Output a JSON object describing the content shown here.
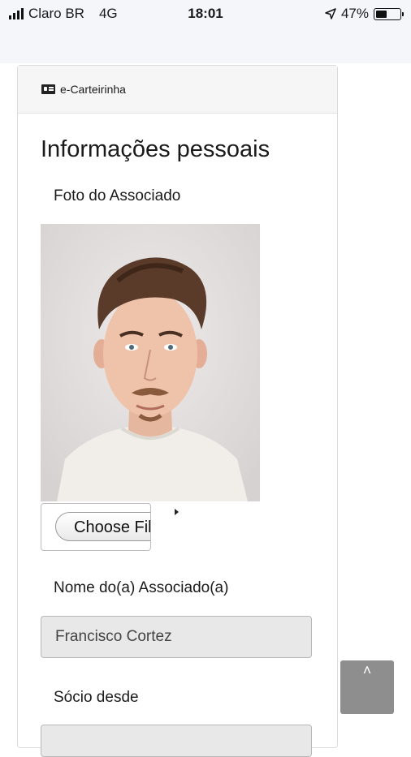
{
  "status_bar": {
    "carrier": "Claro BR",
    "network": "4G",
    "time": "18:01",
    "battery_percent": "47%",
    "battery_level": 0.47
  },
  "header": {
    "title": "e-Carteirinha",
    "icon": "id-card-icon"
  },
  "section": {
    "title": "Informações pessoais"
  },
  "photo": {
    "label": "Foto do Associado",
    "file_button_label": "Choose File"
  },
  "name": {
    "label": "Nome do(a) Associado(a)",
    "value": "Francisco Cortez"
  },
  "member_since": {
    "label": "Sócio desde"
  },
  "scroll_top": {
    "icon": "chevron-up-icon",
    "glyph": "˄"
  }
}
